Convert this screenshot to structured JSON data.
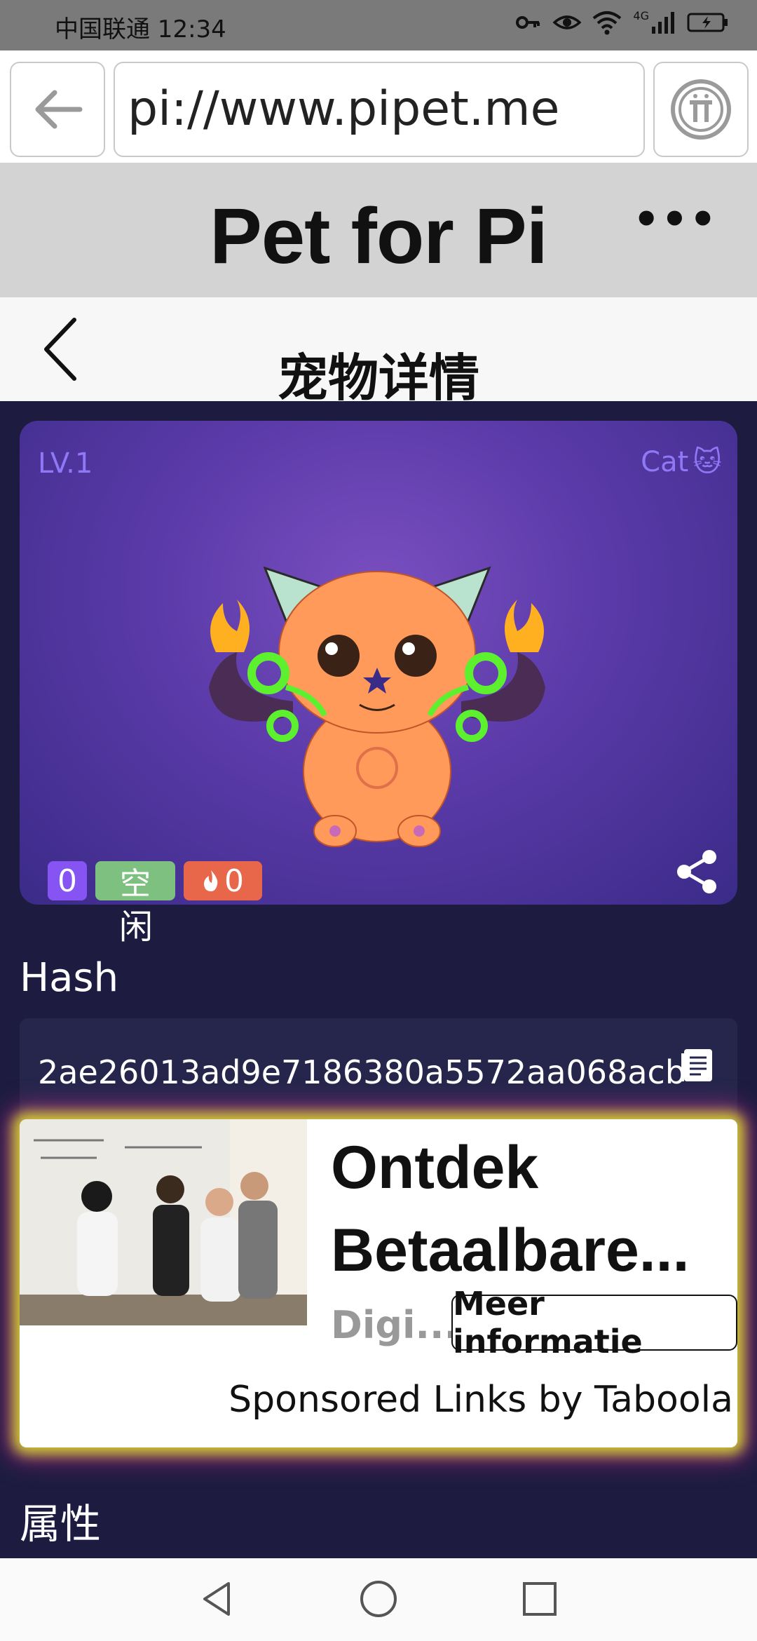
{
  "status_bar": {
    "carrier_time": "中国联通 12:34",
    "network": "4G",
    "icons": [
      "key-icon",
      "eye-icon",
      "wifi-icon",
      "signal-icon",
      "battery-icon"
    ]
  },
  "browser": {
    "url": "pi://www.pipet.me",
    "back_icon": "back-arrow-icon",
    "pi_icon": "pi-logo-icon"
  },
  "app_bar": {
    "title": "Pet for Pi",
    "more_label": "•••"
  },
  "page_header": {
    "title": "宠物详情",
    "back_icon": "chevron-left-icon"
  },
  "pet_card": {
    "level": "LV.1",
    "type": "Cat",
    "type_emoji": "🐱",
    "badge_count": "0",
    "status_line1": "空",
    "status_line2": "闲",
    "fire_count": "0",
    "colors": {
      "level_text": "#8f78f5",
      "badge_purple": "#8654f3",
      "badge_green": "#7dc07f",
      "badge_red": "#e8674a"
    }
  },
  "hash": {
    "label": "Hash",
    "value": "2ae26013ad9e7186380a5572aa068acb"
  },
  "ad": {
    "title": "Ontdek Betaalbare...",
    "source": "Digi...",
    "cta": "Meer informatie",
    "sponsor": "Sponsored Links by Taboola"
  },
  "attributes": {
    "label": "属性"
  },
  "nav_bar": {
    "icons": [
      "back-triangle-icon",
      "home-circle-icon",
      "recent-square-icon"
    ]
  }
}
